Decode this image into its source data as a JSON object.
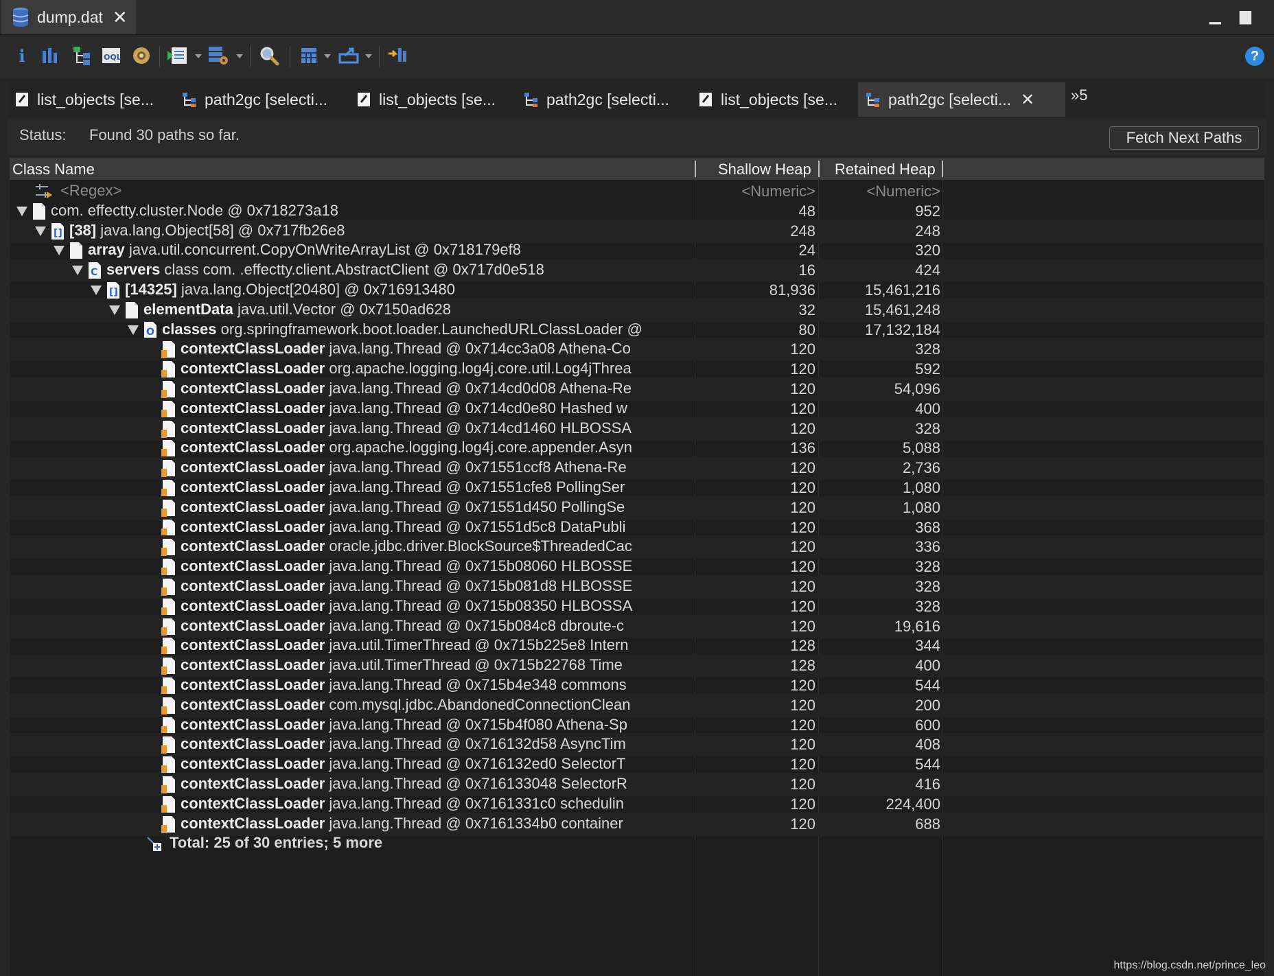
{
  "editor": {
    "file_tab": "dump.dat"
  },
  "toolbar": {
    "icons": [
      "info-icon",
      "histogram-icon",
      "dominator-tree-icon",
      "oql-icon",
      "heap-dump-overview-icon",
      "run-report-icon",
      "query-browser-icon",
      "search-icon",
      "calculate-retained-icon",
      "export-icon",
      "group-result-icon"
    ]
  },
  "tabs": [
    {
      "label": "list_objects  [se...",
      "kind": "list"
    },
    {
      "label": "path2gc  [selecti...",
      "kind": "path"
    },
    {
      "label": "list_objects  [se...",
      "kind": "list"
    },
    {
      "label": "path2gc  [selecti...",
      "kind": "path"
    },
    {
      "label": "list_objects  [se...",
      "kind": "list"
    },
    {
      "label": "path2gc  [selecti...",
      "kind": "path",
      "active": true
    }
  ],
  "more_tabs": "»5",
  "status": {
    "label": "Status:",
    "text": "Found 30 paths so far.",
    "fetch_button": "Fetch Next Paths"
  },
  "table": {
    "columns": [
      "Class Name",
      "Shallow Heap",
      "Retained Heap"
    ],
    "filter": {
      "name": "<Regex>",
      "shallow": "<Numeric>",
      "retained": "<Numeric>"
    },
    "rows": [
      {
        "level": 0,
        "bold": "",
        "text": "com.           effectty.cluster.Node @ 0x718273a18",
        "shallow": "48",
        "retained": "952",
        "icon": "obj"
      },
      {
        "level": 1,
        "bold": "[38]",
        "text": " java.lang.Object[58] @ 0x717fb26e8",
        "shallow": "248",
        "retained": "248",
        "icon": "arr"
      },
      {
        "level": 2,
        "bold": "array",
        "text": " java.util.concurrent.CopyOnWriteArrayList @ 0x718179ef8",
        "shallow": "24",
        "retained": "320",
        "icon": "obj"
      },
      {
        "level": 3,
        "bold": "servers",
        "text": " class com.             .effectty.client.AbstractClient @ 0x717d0e518",
        "shallow": "16",
        "retained": "424",
        "icon": "cls"
      },
      {
        "level": 4,
        "bold": "[14325]",
        "text": " java.lang.Object[20480] @ 0x716913480",
        "shallow": "81,936",
        "retained": "15,461,216",
        "icon": "arr"
      },
      {
        "level": 5,
        "bold": "elementData",
        "text": " java.util.Vector @ 0x7150ad628",
        "shallow": "32",
        "retained": "15,461,248",
        "icon": "obj"
      },
      {
        "level": 6,
        "bold": "classes",
        "text": " org.springframework.boot.loader.LaunchedURLClassLoader @",
        "shallow": "80",
        "retained": "17,132,184",
        "icon": "ldr"
      },
      {
        "level": 7,
        "bold": "contextClassLoader",
        "text": " java.lang.Thread @ 0x714cc3a08  Athena-Co",
        "shallow": "120",
        "retained": "328",
        "icon": "gc"
      },
      {
        "level": 7,
        "bold": "contextClassLoader",
        "text": " org.apache.logging.log4j.core.util.Log4jThrea",
        "shallow": "120",
        "retained": "592",
        "icon": "gc"
      },
      {
        "level": 7,
        "bold": "contextClassLoader",
        "text": " java.lang.Thread @ 0x714cd0d08  Athena-Re",
        "shallow": "120",
        "retained": "54,096",
        "icon": "gc"
      },
      {
        "level": 7,
        "bold": "contextClassLoader",
        "text": " java.lang.Thread @ 0x714cd0e80  Hashed w",
        "shallow": "120",
        "retained": "400",
        "icon": "gc"
      },
      {
        "level": 7,
        "bold": "contextClassLoader",
        "text": " java.lang.Thread @ 0x714cd1460  HLBOSSA",
        "shallow": "120",
        "retained": "328",
        "icon": "gc"
      },
      {
        "level": 7,
        "bold": "contextClassLoader",
        "text": " org.apache.logging.log4j.core.appender.Asyn",
        "shallow": "136",
        "retained": "5,088",
        "icon": "gc"
      },
      {
        "level": 7,
        "bold": "contextClassLoader",
        "text": " java.lang.Thread @ 0x71551ccf8  Athena-Re",
        "shallow": "120",
        "retained": "2,736",
        "icon": "gc"
      },
      {
        "level": 7,
        "bold": "contextClassLoader",
        "text": " java.lang.Thread @ 0x71551cfe8  PollingSer",
        "shallow": "120",
        "retained": "1,080",
        "icon": "gc"
      },
      {
        "level": 7,
        "bold": "contextClassLoader",
        "text": " java.lang.Thread @ 0x71551d450  PollingSe",
        "shallow": "120",
        "retained": "1,080",
        "icon": "gc"
      },
      {
        "level": 7,
        "bold": "contextClassLoader",
        "text": " java.lang.Thread @ 0x71551d5c8  DataPubli",
        "shallow": "120",
        "retained": "368",
        "icon": "gc"
      },
      {
        "level": 7,
        "bold": "contextClassLoader",
        "text": " oracle.jdbc.driver.BlockSource$ThreadedCac",
        "shallow": "120",
        "retained": "336",
        "icon": "gc"
      },
      {
        "level": 7,
        "bold": "contextClassLoader",
        "text": " java.lang.Thread @ 0x715b08060  HLBOSSE",
        "shallow": "120",
        "retained": "328",
        "icon": "gc"
      },
      {
        "level": 7,
        "bold": "contextClassLoader",
        "text": " java.lang.Thread @ 0x715b081d8  HLBOSSE",
        "shallow": "120",
        "retained": "328",
        "icon": "gc"
      },
      {
        "level": 7,
        "bold": "contextClassLoader",
        "text": " java.lang.Thread @ 0x715b08350  HLBOSSA",
        "shallow": "120",
        "retained": "328",
        "icon": "gc"
      },
      {
        "level": 7,
        "bold": "contextClassLoader",
        "text": " java.lang.Thread @ 0x715b084c8  dbroute-c",
        "shallow": "120",
        "retained": "19,616",
        "icon": "gc"
      },
      {
        "level": 7,
        "bold": "contextClassLoader",
        "text": " java.util.TimerThread @ 0x715b225e8  Intern",
        "shallow": "128",
        "retained": "344",
        "icon": "gc"
      },
      {
        "level": 7,
        "bold": "contextClassLoader",
        "text": " java.util.TimerThread @ 0x715b22768  Time",
        "shallow": "128",
        "retained": "400",
        "icon": "gc"
      },
      {
        "level": 7,
        "bold": "contextClassLoader",
        "text": " java.lang.Thread @ 0x715b4e348  commons",
        "shallow": "120",
        "retained": "544",
        "icon": "gc"
      },
      {
        "level": 7,
        "bold": "contextClassLoader",
        "text": " com.mysql.jdbc.AbandonedConnectionClean",
        "shallow": "120",
        "retained": "200",
        "icon": "gc"
      },
      {
        "level": 7,
        "bold": "contextClassLoader",
        "text": " java.lang.Thread @ 0x715b4f080  Athena-Sp",
        "shallow": "120",
        "retained": "600",
        "icon": "gc"
      },
      {
        "level": 7,
        "bold": "contextClassLoader",
        "text": " java.lang.Thread @ 0x716132d58  AsyncTim",
        "shallow": "120",
        "retained": "408",
        "icon": "gc"
      },
      {
        "level": 7,
        "bold": "contextClassLoader",
        "text": " java.lang.Thread @ 0x716132ed0  SelectorT",
        "shallow": "120",
        "retained": "544",
        "icon": "gc"
      },
      {
        "level": 7,
        "bold": "contextClassLoader",
        "text": " java.lang.Thread @ 0x716133048  SelectorR",
        "shallow": "120",
        "retained": "416",
        "icon": "gc"
      },
      {
        "level": 7,
        "bold": "contextClassLoader",
        "text": " java.lang.Thread @ 0x7161331c0  schedulin",
        "shallow": "120",
        "retained": "224,400",
        "icon": "gc"
      },
      {
        "level": 7,
        "bold": "contextClassLoader",
        "text": " java.lang.Thread @ 0x7161334b0  container",
        "shallow": "120",
        "retained": "688",
        "icon": "gc"
      }
    ],
    "total": "Total: 25 of 30 entries; 5 more"
  },
  "watermark": "https://blog.csdn.net/prince_leo"
}
